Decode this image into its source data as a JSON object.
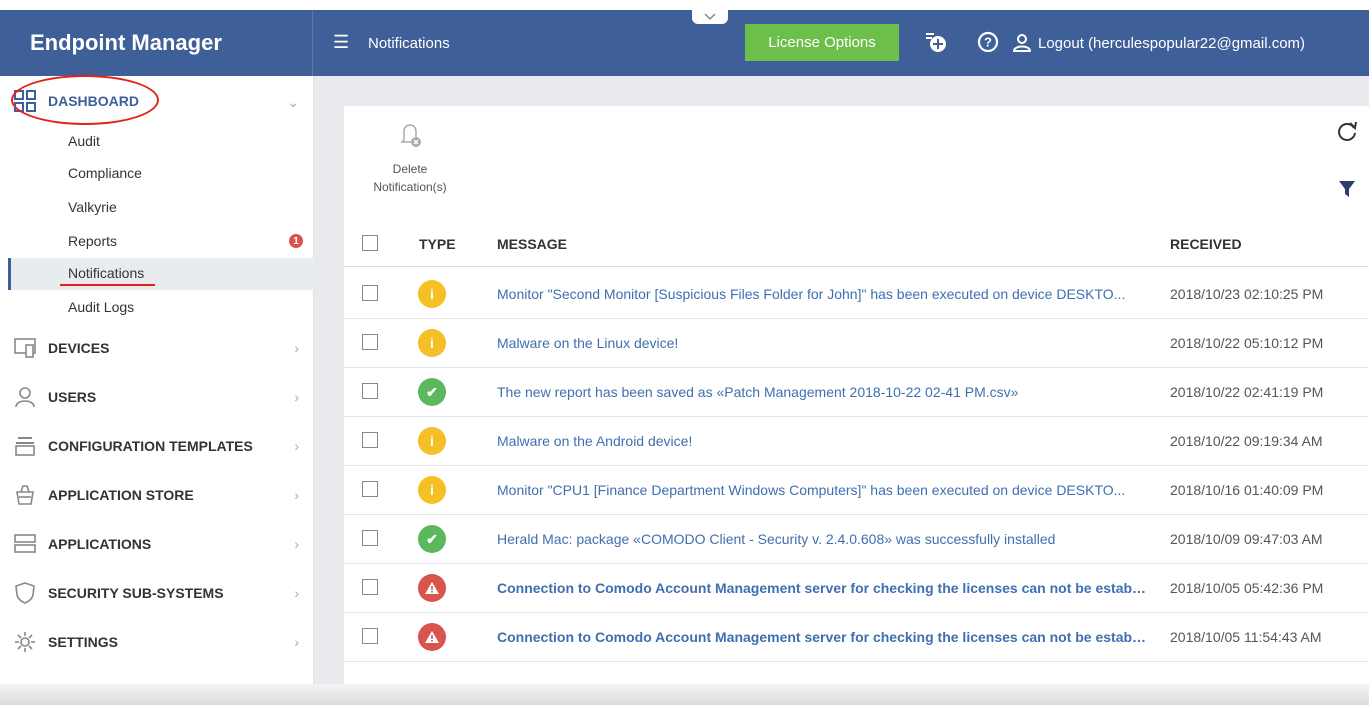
{
  "header": {
    "brand": "Endpoint Manager",
    "page_title": "Notifications",
    "license_button": "License Options",
    "logout_text": "Logout (herculespopular22@gmail.com)"
  },
  "sidebar": {
    "dashboard": {
      "label": "DASHBOARD",
      "children": [
        "Audit",
        "Compliance",
        "Valkyrie",
        "Reports",
        "Notifications",
        "Audit Logs"
      ],
      "reports_badge": "1"
    },
    "sections": [
      {
        "label": "DEVICES",
        "icon": "devices-icon"
      },
      {
        "label": "USERS",
        "icon": "user-icon"
      },
      {
        "label": "CONFIGURATION TEMPLATES",
        "icon": "templates-icon"
      },
      {
        "label": "APPLICATION STORE",
        "icon": "store-icon"
      },
      {
        "label": "APPLICATIONS",
        "icon": "applications-icon"
      },
      {
        "label": "SECURITY SUB-SYSTEMS",
        "icon": "shield-icon"
      },
      {
        "label": "SETTINGS",
        "icon": "gear-icon"
      }
    ]
  },
  "toolbar": {
    "delete_label": "Delete Notification(s)"
  },
  "table": {
    "columns": [
      "TYPE",
      "MESSAGE",
      "RECEIVED"
    ],
    "rows": [
      {
        "type": "info",
        "message": "Monitor \"Second Monitor [Suspicious Files Folder for John]\" has been executed on device DESKTO...",
        "received": "2018/10/23 02:10:25 PM",
        "bold": false
      },
      {
        "type": "info",
        "message": "Malware on the Linux device!",
        "received": "2018/10/22 05:10:12 PM",
        "bold": false
      },
      {
        "type": "success",
        "message": "The new report has been saved as «Patch Management 2018-10-22 02-41 PM.csv»",
        "received": "2018/10/22 02:41:19 PM",
        "bold": false
      },
      {
        "type": "info",
        "message": "Malware on the Android device!",
        "received": "2018/10/22 09:19:34 AM",
        "bold": false
      },
      {
        "type": "info",
        "message": "Monitor \"CPU1 [Finance Department Windows Computers]\" has been executed on device DESKTO...",
        "received": "2018/10/16 01:40:09 PM",
        "bold": false
      },
      {
        "type": "success",
        "message": "Herald Mac: package «COMODO Client - Security v. 2.4.0.608» was successfully installed",
        "received": "2018/10/09 09:47:03 AM",
        "bold": false
      },
      {
        "type": "error",
        "message": "Connection to Comodo Account Management server for checking the licenses can not be establi...",
        "received": "2018/10/05 05:42:36 PM",
        "bold": true
      },
      {
        "type": "error",
        "message": "Connection to Comodo Account Management server for checking the licenses can not be establi...",
        "received": "2018/10/05 11:54:43 AM",
        "bold": true
      }
    ]
  },
  "colors": {
    "header_bg": "#3f5f99",
    "license_btn": "#6cc04a",
    "info": "#f5c026",
    "success": "#5cb85c",
    "error": "#d9534f",
    "link": "#3f6fb0",
    "highlight": "#e2231a"
  }
}
